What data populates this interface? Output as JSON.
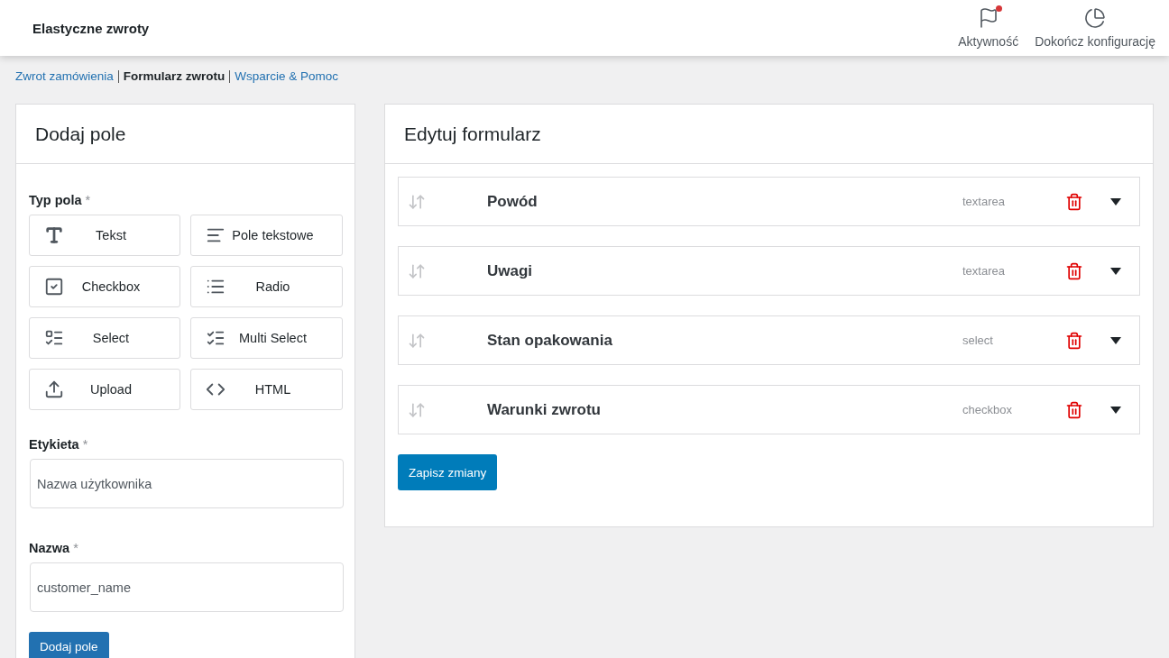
{
  "header": {
    "title": "Elastyczne zwroty",
    "actions": [
      {
        "kind": "activity",
        "label": "Aktywność",
        "notification": true
      },
      {
        "kind": "setup",
        "label": "Dokończ konfigurację",
        "notification": false
      }
    ]
  },
  "breadcrumbs": [
    {
      "label": "Zwrot zamówienia",
      "selected": false
    },
    {
      "label": "Formularz zwrotu",
      "selected": true
    },
    {
      "label": "Wsparcie & Pomoc",
      "selected": false
    }
  ],
  "add_field": {
    "title": "Dodaj pole",
    "type_label": {
      "text": "Typ pola",
      "required_mark": "*"
    },
    "field_types": [
      {
        "kind": "text",
        "label": "Tekst"
      },
      {
        "kind": "textarea",
        "label": "Pole tekstowe"
      },
      {
        "kind": "checkbox",
        "label": "Checkbox"
      },
      {
        "kind": "radio",
        "label": "Radio"
      },
      {
        "kind": "select",
        "label": "Select"
      },
      {
        "kind": "multiselect",
        "label": "Multi Select"
      },
      {
        "kind": "upload",
        "label": "Upload"
      },
      {
        "kind": "html",
        "label": "HTML"
      }
    ],
    "inputs": [
      {
        "label": "Etykieta",
        "required_mark": "*",
        "placeholder": "Nazwa użytkownika"
      },
      {
        "label": "Nazwa",
        "required_mark": "*",
        "placeholder": "customer_name"
      }
    ],
    "button": "Dodaj pole"
  },
  "edit_form": {
    "title": "Edytuj formularz",
    "fields": [
      {
        "label": "Powód",
        "type": "textarea",
        "expanded": false
      },
      {
        "label": "Uwagi",
        "type": "textarea",
        "expanded": false
      },
      {
        "label": "Stan opakowania",
        "type": "select",
        "expanded": false
      },
      {
        "label": "Warunki zwrotu",
        "type": "checkbox",
        "expanded": false
      }
    ],
    "button": "Zapisz zmiany"
  }
}
